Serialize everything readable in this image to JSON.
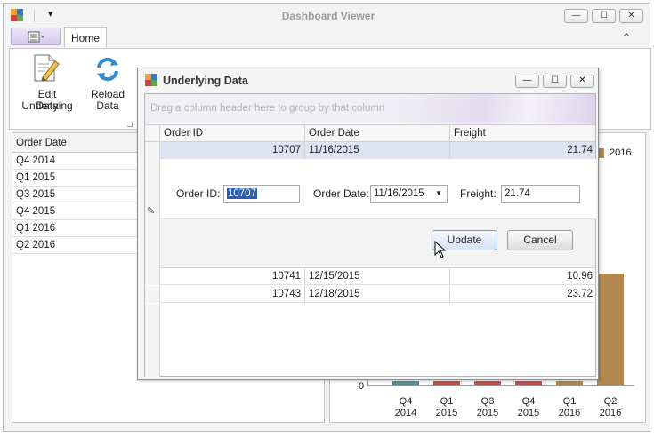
{
  "window": {
    "title": "Dashboard Viewer",
    "controls": {
      "minimize": "—",
      "maximize": "☐",
      "close": "✕"
    }
  },
  "ribbon": {
    "qat_arrow": "▾",
    "collapse_glyph": "⌃",
    "tabs": [
      {
        "label": "Home"
      }
    ],
    "buttons": [
      {
        "label_line1": "Edit Underlying",
        "label_line2": "Data"
      },
      {
        "label_line1": "Reload",
        "label_line2": "Data"
      }
    ]
  },
  "left_grid": {
    "header": "Order Date",
    "rows": [
      "Q4 2014",
      "Q1 2015",
      "Q3 2015",
      "Q4 2015",
      "Q1 2016",
      "Q2 2016"
    ]
  },
  "chart": {
    "legend_label": "2016",
    "y_zero": "0",
    "colors": {
      "2014": "#5a8f9e",
      "2015": "#c0504d",
      "2016": "#b08850"
    },
    "chart_data": {
      "type": "bar",
      "categories": [
        "Q4 2014",
        "Q1 2015",
        "Q3 2015",
        "Q4 2015",
        "Q1 2016",
        "Q2 2016"
      ],
      "visible_legend": [
        "2016"
      ],
      "series": [
        {
          "name": "2016",
          "values": [
            null,
            null,
            null,
            null,
            null,
            0.6
          ]
        }
      ],
      "x_labels": [
        [
          "Q4",
          "2014"
        ],
        [
          "Q1",
          "2015"
        ],
        [
          "Q3",
          "2015"
        ],
        [
          "Q4",
          "2015"
        ],
        [
          "Q1",
          "2016"
        ],
        [
          "Q2",
          "2016"
        ]
      ]
    }
  },
  "dialog": {
    "title": "Underlying Data",
    "group_panel_hint": "Drag a column header here to group by that column",
    "columns": [
      "Order ID",
      "Order Date",
      "Freight"
    ],
    "rows": [
      {
        "order_id": "10707",
        "order_date": "11/16/2015",
        "freight": "21.74"
      },
      {
        "order_id": "10741",
        "order_date": "12/15/2015",
        "freight": "10.96"
      },
      {
        "order_id": "10743",
        "order_date": "12/18/2015",
        "freight": "23.72"
      }
    ],
    "edit_form": {
      "order_id_label": "Order ID:",
      "order_id_value": "10707",
      "order_date_label": "Order Date:",
      "order_date_value": "11/16/2015",
      "freight_label": "Freight:",
      "freight_value": "21.74",
      "update_label": "Update",
      "cancel_label": "Cancel",
      "edit_indicator": "✎"
    }
  }
}
